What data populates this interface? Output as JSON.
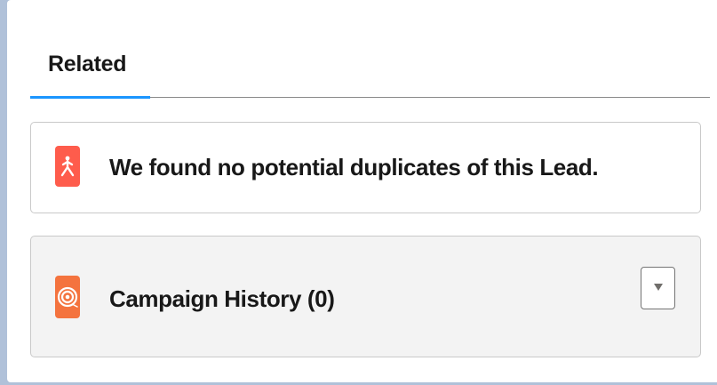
{
  "tabs": {
    "items": [
      {
        "label": "Related",
        "active": true
      }
    ]
  },
  "duplicates_card": {
    "message": "We found no potential duplicates of this Lead.",
    "icon": "person-merge-icon",
    "icon_color": "#fe5c4c"
  },
  "campaign_card": {
    "title": "Campaign History (0)",
    "icon": "campaign-target-icon",
    "icon_color": "#f4733e",
    "menu_icon": "chevron-down-icon"
  },
  "colors": {
    "page_background": "#b0c1d9",
    "active_tab_accent": "#1b96ff",
    "campaign_card_background": "#f3f3f3"
  }
}
